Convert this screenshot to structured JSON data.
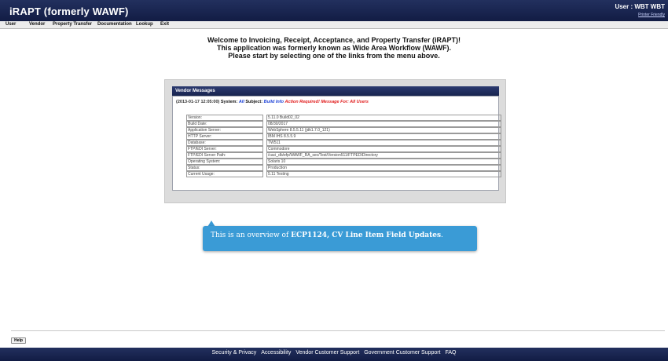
{
  "app": {
    "title": "iRAPT (formerly WAWF)"
  },
  "header": {
    "user_label": "User : WBT WBT",
    "printer_friendly": "Printer Friendly"
  },
  "menu": [
    {
      "label": "User"
    },
    {
      "label": "Vendor"
    },
    {
      "label": "Property Transfer"
    },
    {
      "label": "Documentation"
    },
    {
      "label": "Lookup"
    },
    {
      "label": "Exit"
    }
  ],
  "welcome": {
    "line1": "Welcome to Invoicing, Receipt, Acceptance, and Property Transfer (iRAPT)!",
    "line2": "This application was formerly known as Wide Area Workflow (WAWF).",
    "line3": "Please start by selecting one of the links from the menu above."
  },
  "vendor_messages": {
    "title": "Vendor Messages",
    "date": "(2013-01-17 12:05:00)",
    "system_key": "System:",
    "system_value": "All",
    "subject_key": "Subject:",
    "subject_value": "Build Info",
    "action": "Action Required!",
    "audience": "Message For: All Users",
    "rows": [
      {
        "label": "Version:",
        "value": "5.11.0  Build02_02"
      },
      {
        "label": "Build Date:",
        "value": "08/30/2017"
      },
      {
        "label": "Application Server:",
        "value": "WebSphere 8.5.5.11 (jdk1.7.0_121)"
      },
      {
        "label": "HTTP Server:",
        "value": "IBM IHS 8.5.5.9"
      },
      {
        "label": "Database:",
        "value": "TW511"
      },
      {
        "label": "FTP/EDI Server:",
        "value": "Commodore"
      },
      {
        "label": "FTP/EDI Server Path:",
        "value": "/caci_db/efp/WAWF_RA_sec/Test/Version511/FTPEDIDirectory"
      },
      {
        "label": "Operating System:",
        "value": "Solaris 10"
      },
      {
        "label": "Status:",
        "value": "Production"
      },
      {
        "label": "Current Usage:",
        "value": "5.11 Testing"
      }
    ]
  },
  "callout": {
    "prefix": "This is an overview of ",
    "bold": "ECP1124, CV Line Item Field Updates",
    "suffix": "."
  },
  "help_button": "Help",
  "footer": {
    "links": [
      "Security & Privacy",
      "Accessibility",
      "Vendor Customer Support",
      "Government Customer Support",
      "FAQ"
    ]
  },
  "colors": {
    "header_bg": "#1b2650",
    "callout_bg": "#3a9bd6",
    "action_red": "#e01818",
    "link_blue": "#1a3fd6"
  }
}
